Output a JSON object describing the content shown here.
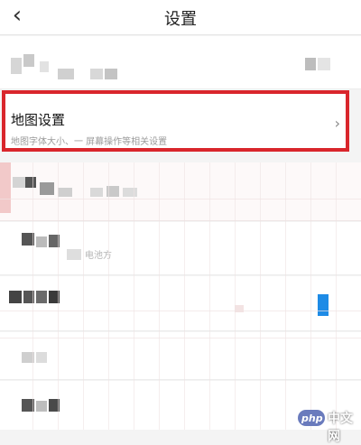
{
  "header": {
    "title": "设置",
    "back_icon": "chevron-left-icon"
  },
  "map_settings": {
    "title": "地图设置",
    "subtitle": "地图字体大小、一     屏幕操作等相关设置",
    "chevron_icon": "chevron-right-icon"
  },
  "row_partial_text": "电池方",
  "watermark": {
    "badge": "php",
    "text": "中文网"
  },
  "colors": {
    "highlight_border": "#d9262c",
    "accent_blue": "#1e8be6"
  }
}
